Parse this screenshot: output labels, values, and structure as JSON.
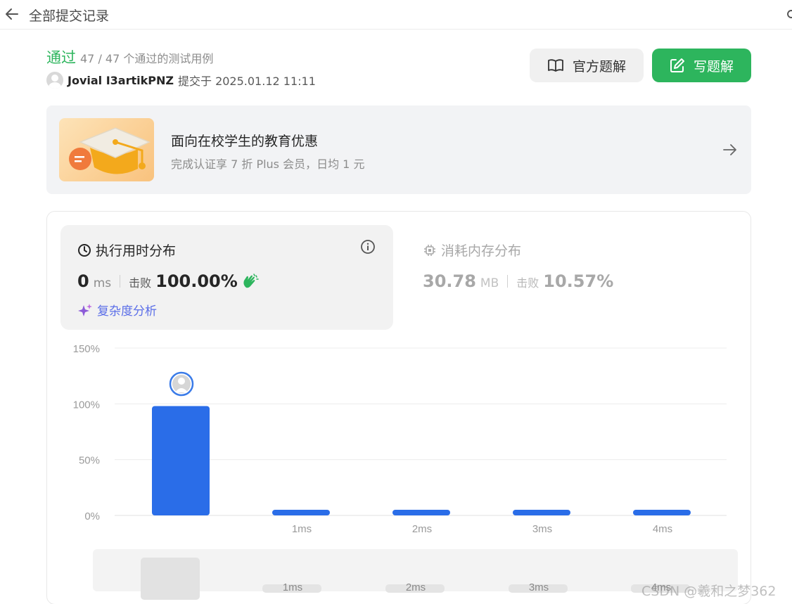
{
  "header": {
    "title": "全部提交记录",
    "back_icon": "arrow-left-icon"
  },
  "submission": {
    "status": "通过",
    "tests": "47 / 47 个通过的测试用例",
    "user": "Jovial I3artikPNZ",
    "submitted": "提交于 2025.01.12 11:11"
  },
  "actions": {
    "official_solution": "官方题解",
    "write_solution": "写题解"
  },
  "promo": {
    "title": "面向在校学生的教育优惠",
    "subtitle": "完成认证享 7 折 Plus 会员，日均 1 元"
  },
  "runtime": {
    "title": "执行用时分布",
    "value": "0",
    "unit": "ms",
    "beat_label": "击败",
    "beat_value": "100.00%",
    "complexity": "复杂度分析"
  },
  "memory": {
    "title": "消耗内存分布",
    "value": "30.78",
    "unit": "MB",
    "beat_label": "击败",
    "beat_value": "10.57%"
  },
  "colors": {
    "accent_green": "#2db55d",
    "bar_blue": "#2a6de8",
    "complexity_purple": "#5b6ee8"
  },
  "chart_data": {
    "type": "bar",
    "categories": [
      "",
      "1ms",
      "2ms",
      "3ms",
      "4ms"
    ],
    "values": [
      98,
      2,
      2,
      2,
      2
    ],
    "y_ticks": [
      "0%",
      "50%",
      "100%",
      "150%"
    ],
    "ylim": [
      0,
      150
    ],
    "grid": true,
    "current_marker_category": 0,
    "overview_labels": [
      "1ms",
      "2ms",
      "3ms",
      "4ms"
    ]
  },
  "watermark": "CSDN @羲和之梦362"
}
